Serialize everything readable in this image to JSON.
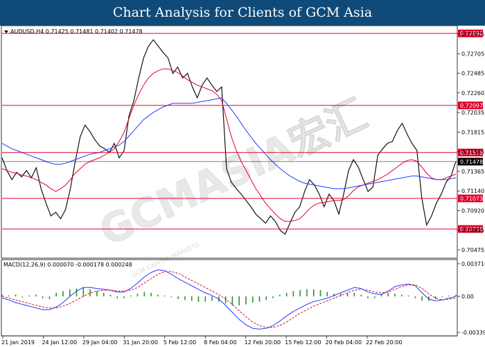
{
  "banner": {
    "title": "Chart Analysis for Clients of GCM Asia"
  },
  "watermark": {
    "text": "GCMASIA宏汇",
    "subtext": "GCM CAPITAL MARKETS"
  },
  "chart_data": [
    {
      "type": "candlestick",
      "header": "AUDUSD,H4  0.71425 0.71481 0.71402 0.71478",
      "ylim": [
        0.7043,
        0.7296
      ],
      "y_tick_labels": [
        "0.72975",
        "0.72705",
        "0.72485",
        "0.72260",
        "0.72035",
        "0.71815",
        "0.71585",
        "0.71365",
        "0.71140",
        "0.70920",
        "0.70695",
        "0.70475"
      ],
      "x_tick_labels": [
        "21 Jan 2019",
        "24 Jan 12:00",
        "29 Jan 04:00",
        "31 Jan 20:00",
        "5 Feb 12:00",
        "8 Feb 04:00",
        "12 Feb 20:00",
        "15 Feb 12:00",
        "20 Feb 04:00",
        "22 Feb 20:00"
      ],
      "levels": [
        {
          "value": "0.72890",
          "color": "#e0002a"
        },
        {
          "value": "0.72097",
          "color": "#e0002a"
        },
        {
          "value": "0.71578",
          "color": "#e0002a"
        },
        {
          "value": "0.71478",
          "color": "#000000"
        },
        {
          "value": "0.71073",
          "color": "#e0002a"
        },
        {
          "value": "0.70736",
          "color": "#e0002a"
        }
      ],
      "series": [
        {
          "color": "#111111",
          "values": [
            0.7152,
            0.7138,
            0.7128,
            0.7136,
            0.7131,
            0.7138,
            0.713,
            0.7141,
            0.7118,
            0.7102,
            0.7088,
            0.7092,
            0.7085,
            0.7095,
            0.7118,
            0.7148,
            0.7175,
            0.7188,
            0.7181,
            0.7172,
            0.7165,
            0.7162,
            0.7158,
            0.7168,
            0.7152,
            0.716,
            0.7198,
            0.7215,
            0.724,
            0.7262,
            0.7275,
            0.7282,
            0.7275,
            0.7268,
            0.7262,
            0.7245,
            0.7252,
            0.724,
            0.7245,
            0.723,
            0.7218,
            0.7232,
            0.724,
            0.7232,
            0.7225,
            0.723,
            0.714,
            0.7125,
            0.7118,
            0.7112,
            0.7105,
            0.7098,
            0.709,
            0.7085,
            0.708,
            0.7088,
            0.7082,
            0.7072,
            0.7068,
            0.708,
            0.7092,
            0.7098,
            0.7115,
            0.7128,
            0.7122,
            0.7112,
            0.7098,
            0.7112,
            0.7105,
            0.709,
            0.7112,
            0.7138,
            0.715,
            0.7142,
            0.7128,
            0.7115,
            0.712,
            0.7155,
            0.7162,
            0.7168,
            0.717,
            0.7182,
            0.719,
            0.7178,
            0.7168,
            0.716,
            0.7108,
            0.7078,
            0.7088,
            0.7102,
            0.7112,
            0.7125,
            0.7132,
            0.7148
          ]
        },
        {
          "color": "#e0002a",
          "values": [
            0.714,
            0.7138,
            0.7136,
            0.7135,
            0.7133,
            0.7132,
            0.713,
            0.7128,
            0.7125,
            0.7122,
            0.7118,
            0.7115,
            0.7118,
            0.7122,
            0.7128,
            0.7135,
            0.714,
            0.7145,
            0.7148,
            0.715,
            0.7152,
            0.7155,
            0.7158,
            0.7162,
            0.717,
            0.718,
            0.7195,
            0.721,
            0.7222,
            0.7232,
            0.724,
            0.7245,
            0.7248,
            0.725,
            0.725,
            0.7248,
            0.7246,
            0.7242,
            0.7238,
            0.7235,
            0.7232,
            0.723,
            0.7228,
            0.7226,
            0.7222,
            0.7215,
            0.7195,
            0.7175,
            0.716,
            0.7148,
            0.7138,
            0.7128,
            0.7118,
            0.711,
            0.7102,
            0.7096,
            0.709,
            0.7085,
            0.7082,
            0.7082,
            0.7083,
            0.7085,
            0.709,
            0.7096,
            0.71,
            0.7102,
            0.7103,
            0.7104,
            0.7105,
            0.7105,
            0.7106,
            0.711,
            0.7116,
            0.712,
            0.7122,
            0.7124,
            0.7126,
            0.7128,
            0.7131,
            0.7134,
            0.7138,
            0.7142,
            0.7146,
            0.7149,
            0.715,
            0.7148,
            0.7142,
            0.7135,
            0.713,
            0.7128,
            0.7128,
            0.713,
            0.7132,
            0.7134
          ]
        },
        {
          "color": "#1f3cff",
          "values": [
            0.7168,
            0.7165,
            0.7162,
            0.716,
            0.7158,
            0.7156,
            0.7154,
            0.7152,
            0.715,
            0.7148,
            0.7146,
            0.7145,
            0.7145,
            0.7146,
            0.7148,
            0.715,
            0.7152,
            0.7154,
            0.7156,
            0.7157,
            0.7158,
            0.716,
            0.7162,
            0.7164,
            0.7166,
            0.717,
            0.7176,
            0.7182,
            0.7188,
            0.7194,
            0.7198,
            0.7202,
            0.7205,
            0.7208,
            0.721,
            0.7212,
            0.7212,
            0.7212,
            0.7212,
            0.7212,
            0.7213,
            0.7214,
            0.7215,
            0.7216,
            0.7217,
            0.7218,
            0.7212,
            0.7205,
            0.7198,
            0.719,
            0.7182,
            0.7175,
            0.7168,
            0.7162,
            0.7156,
            0.715,
            0.7145,
            0.714,
            0.7136,
            0.7132,
            0.7129,
            0.7126,
            0.7124,
            0.7123,
            0.7122,
            0.7121,
            0.712,
            0.7119,
            0.7118,
            0.7118,
            0.7118,
            0.7119,
            0.712,
            0.7121,
            0.7122,
            0.7123,
            0.7124,
            0.7125,
            0.7126,
            0.7127,
            0.7128,
            0.7129,
            0.713,
            0.7131,
            0.7132,
            0.7132,
            0.7131,
            0.713,
            0.7129,
            0.7128,
            0.7128,
            0.7128,
            0.7129,
            0.713
          ]
        }
      ]
    },
    {
      "type": "macd",
      "label": "MACD(12,26,9) 0.000070 -0.000178 0.000248",
      "ylim": [
        -0.0043,
        0.004
      ],
      "y_tick_labels": [
        "0.003716",
        "0.00",
        "-0.003395"
      ],
      "series": [
        {
          "type": "line",
          "color": "#1f3cff",
          "values": [
            -0.0002,
            -0.0004,
            -0.0007,
            -0.0009,
            -0.0011,
            -0.0013,
            -0.0015,
            -0.0015,
            -0.0012,
            -0.0007,
            0.0,
            0.0006,
            0.001,
            0.001,
            0.0009,
            0.0008,
            0.0007,
            0.0005,
            0.0005,
            0.0009,
            0.0015,
            0.0022,
            0.0027,
            0.003,
            0.0029,
            0.0025,
            0.002,
            0.0016,
            0.0012,
            0.0008,
            0.0004,
            0.0001,
            -0.0003,
            -0.001,
            -0.0018,
            -0.0026,
            -0.0032,
            -0.0036,
            -0.0037,
            -0.0036,
            -0.0033,
            -0.0028,
            -0.0022,
            -0.0017,
            -0.0013,
            -0.0009,
            -0.0006,
            -0.0004,
            -0.0002,
            0.0001,
            0.0004,
            0.0007,
            0.001,
            0.0009,
            0.0005,
            0.0003,
            0.0002,
            0.0006,
            0.0011,
            0.0013,
            0.0014,
            0.0012,
            0.0004,
            -0.0003,
            -0.0005,
            -0.0004,
            -0.0002,
            0.0
          ]
        },
        {
          "type": "line",
          "color": "#e0002a",
          "dashed": true,
          "values": [
            0.0,
            -0.0002,
            -0.0004,
            -0.0006,
            -0.0008,
            -0.001,
            -0.0012,
            -0.0013,
            -0.0013,
            -0.0011,
            -0.0008,
            -0.0004,
            0.0,
            0.0004,
            0.0006,
            0.0007,
            0.0007,
            0.0006,
            0.0006,
            0.0007,
            0.001,
            0.0015,
            0.002,
            0.0025,
            0.0028,
            0.0028,
            0.0026,
            0.0022,
            0.0018,
            0.0014,
            0.001,
            0.0006,
            0.0002,
            -0.0003,
            -0.0009,
            -0.0016,
            -0.0023,
            -0.0029,
            -0.0033,
            -0.0035,
            -0.0035,
            -0.0033,
            -0.0029,
            -0.0024,
            -0.0019,
            -0.0015,
            -0.0011,
            -0.0008,
            -0.0005,
            -0.0002,
            0.0001,
            0.0004,
            0.0007,
            0.0008,
            0.0007,
            0.0005,
            0.0004,
            0.0005,
            0.0008,
            0.0011,
            0.0013,
            0.0013,
            0.0009,
            0.0003,
            -0.0002,
            -0.0004,
            -0.0003,
            -0.0002
          ]
        },
        {
          "type": "histogram",
          "color": "#2f8f2f",
          "values": [
            0.0002,
            0.0001,
            0.0002,
            -0.0001,
            0.0001,
            0.0002,
            -0.0002,
            -0.0003,
            0.0004,
            0.0006,
            0.0008,
            0.0009,
            0.001,
            0.0008,
            0.0006,
            0.0004,
            0.0002,
            -0.0002,
            -0.0002,
            0.0001,
            0.0003,
            0.0005,
            0.0004,
            0.0002,
            0.0001,
            -0.0001,
            -0.0003,
            -0.0004,
            -0.0005,
            -0.0006,
            -0.0006,
            -0.0005,
            -0.0006,
            -0.0008,
            -0.001,
            -0.001,
            -0.0009,
            -0.0007,
            -0.0006,
            -0.0004,
            -0.0002,
            0.0002,
            0.0004,
            0.0006,
            0.0007,
            0.0008,
            0.0008,
            0.0007,
            0.0005,
            0.0003,
            0.0003,
            0.0004,
            0.0004,
            0.0002,
            -0.0002,
            -0.0002,
            0.0003,
            0.0004,
            0.0003,
            0.0002,
            0.0001,
            -0.0002,
            -0.0005,
            -0.0005,
            -0.0003,
            -0.0001,
            0.0001,
            0.0002
          ]
        }
      ]
    }
  ]
}
